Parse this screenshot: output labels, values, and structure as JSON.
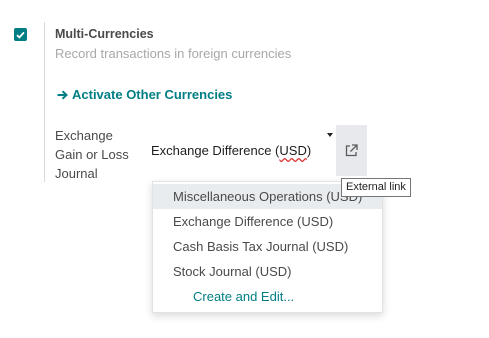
{
  "setting": {
    "title": "Multi-Currencies",
    "description": "Record transactions in foreign currencies",
    "checked": true,
    "activate_link": "Activate Other Currencies"
  },
  "field": {
    "label_lines": [
      "Exchange",
      "Gain or Loss",
      "Journal"
    ],
    "value_prefix": "Exchange Difference (",
    "value_underlined": "USD",
    "value_suffix": ")",
    "external_tooltip": "External link",
    "external_icon": "external-link-icon"
  },
  "dropdown": {
    "options": [
      "Miscellaneous Operations (USD)",
      "Exchange Difference (USD)",
      "Cash Basis Tax Journal (USD)",
      "Stock Journal (USD)"
    ],
    "create_label": "Create and Edit..."
  },
  "colors": {
    "accent": "#017e84",
    "muted_text": "#a8a8a8",
    "highlight": "#e9ecef"
  }
}
